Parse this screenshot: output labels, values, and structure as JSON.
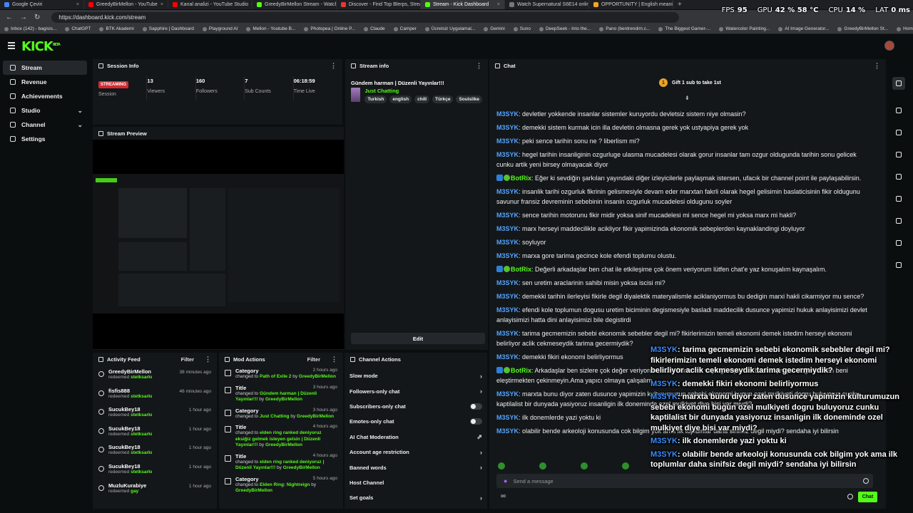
{
  "browser": {
    "tabs": [
      {
        "label": "Google Çeviri",
        "color": "#4285f4"
      },
      {
        "label": "GreedyBirMellon - YouTube",
        "color": "#ff0000"
      },
      {
        "label": "Kanal analizi - YouTube Studio",
        "color": "#ff0000"
      },
      {
        "label": "GreedyBirMellon Stream - Watch",
        "color": "#53fc18"
      },
      {
        "label": "Discover - Find Top Blerps, Strea",
        "color": "#e53935"
      },
      {
        "label": "Stream - Kick Dashboard",
        "color": "#53fc18"
      },
      {
        "label": "Watch Supernatural S6E14 online",
        "color": "#777777"
      },
      {
        "label": "OPPORTUNITY | English meaning",
        "color": "#f5a623"
      }
    ],
    "url": "https://dashboard.kick.com/stream",
    "bookmarks": [
      "Inbox (142) - bagisis...",
      "ChatGPT",
      "BTK Akademi",
      "Sapphire | Dashboard",
      "Playground AI",
      "Mellon - Youtube B...",
      "Photopea | Online P...",
      "Claude",
      "Camper",
      "Ücretsiz Uygulamal...",
      "Gemini",
      "Suno",
      "DeepSeek - Into the...",
      "Pano (bentrendim.c...",
      "The Biggest Gamer-...",
      "Watercolor Painting...",
      "AI Image Generator...",
      "GreedyBirMellon St...",
      "Home / X"
    ]
  },
  "overlay_stats": {
    "fps_label": "FPS",
    "fps": "95",
    "gpu_label": "GPU",
    "gpu": "42 % 58 °C",
    "cpu_label": "CPU",
    "cpu": "14 %",
    "lat_label": "LAT",
    "lat": "0 ms"
  },
  "header": {
    "logo": "KICK",
    "logo_sup": "BETA"
  },
  "sidebar": {
    "items": [
      {
        "label": "Stream",
        "active": true,
        "chevron": false
      },
      {
        "label": "Revenue",
        "chevron": false
      },
      {
        "label": "Achievements",
        "chevron": false
      },
      {
        "label": "Studio",
        "chevron": true
      },
      {
        "label": "Channel",
        "chevron": true
      },
      {
        "label": "Settings",
        "chevron": false
      }
    ]
  },
  "session": {
    "title": "Session Info",
    "status": "STREAMING",
    "status_label": "Session",
    "viewers": "13",
    "viewers_label": "Viewers",
    "followers": "160",
    "followers_label": "Followers",
    "subs": "7",
    "subs_label": "Sub Counts",
    "time": "06:18:59",
    "time_label": "Time Live"
  },
  "preview": {
    "title": "Stream Preview"
  },
  "stream_info": {
    "title": "Stream info",
    "stream_title": "Gündem harman | Düzenli Yayınlar!!!",
    "category": "Just Chatting",
    "tags": [
      "Turkish",
      "english",
      "chill",
      "Türkçe",
      "Soulslike"
    ],
    "edit_label": "Edit"
  },
  "activity": {
    "title": "Activity Feed",
    "filter": "Filter",
    "items": [
      {
        "name": "GreedyBirMellon",
        "sub": "redeemed",
        "reward": "stetksarkı",
        "time": "38 minutes ago"
      },
      {
        "name": "fisfis888",
        "sub": "redeemed",
        "reward": "stetksarkı",
        "time": "46 minutes ago"
      },
      {
        "name": "SucukBey18",
        "sub": "redeemed",
        "reward": "stetksarkı",
        "time": "1 hour ago"
      },
      {
        "name": "SucukBey18",
        "sub": "redeemed",
        "reward": "stetksarkı",
        "time": "1 hour ago"
      },
      {
        "name": "SucukBey18",
        "sub": "redeemed",
        "reward": "stetksarkı",
        "time": "1 hour ago"
      },
      {
        "name": "SucukBey18",
        "sub": "redeemed",
        "reward": "stetksarkı",
        "time": "1 hour ago"
      },
      {
        "name": "MuzluKurabiye",
        "sub": "redeemed",
        "reward": "gay",
        "time": "1 hour ago"
      }
    ]
  },
  "mod": {
    "title": "Mod Actions",
    "filter": "Filter",
    "items": [
      {
        "type": "Category",
        "time": "2 hours ago",
        "pre": "changed to",
        "value": "Path of Exile 2",
        "by": "by",
        "user": "GreedyBirMellon"
      },
      {
        "type": "Title",
        "time": "3 hours ago",
        "pre": "changed to",
        "value": "Gündem harman | Düzenli Yayınlar!!!",
        "by": "by",
        "user": "GreedyBirMellon"
      },
      {
        "type": "Category",
        "time": "3 hours ago",
        "pre": "changed to",
        "value": "Just Chatting",
        "by": "by",
        "user": "GreedyBirMellon"
      },
      {
        "type": "Title",
        "time": "4 hours ago",
        "pre": "changed to",
        "value": "elden ring ranked deniyoruz eksiğiz gelmek isteyen gelsin | Düzenli Yayınlar!!!",
        "by": "by",
        "user": "GreedyBirMellon"
      },
      {
        "type": "Title",
        "time": "4 hours ago",
        "pre": "changed to",
        "value": "elden ring ranked deniyoruz | Düzenli Yayınlar!!!",
        "by": "by",
        "user": "GreedyBirMellon"
      },
      {
        "type": "Category",
        "time": "5 hours ago",
        "pre": "changed to",
        "value": "Elden Ring: Nightreign",
        "by": "by",
        "user": "GreedyBirMellon"
      }
    ]
  },
  "channel_actions": {
    "title": "Channel Actions",
    "items": [
      {
        "label": "Slow mode",
        "control": "chevron"
      },
      {
        "label": "Followers-only chat",
        "control": "chevron"
      },
      {
        "label": "Subscribers-only chat",
        "control": "toggle"
      },
      {
        "label": "Emotes-only chat",
        "control": "toggle"
      },
      {
        "label": "AI Chat Moderation",
        "control": "chart"
      },
      {
        "label": "Account age restriction",
        "control": "chevron"
      },
      {
        "label": "Banned words",
        "control": "chevron"
      },
      {
        "label": "Host Channel",
        "control": "none"
      },
      {
        "label": "Set goals",
        "control": "chevron"
      }
    ]
  },
  "chat": {
    "title": "Chat",
    "gift_count": "1",
    "gift_text": "Gift 1 sub to take 1st",
    "input_placeholder": "Send a message",
    "send_label": "Chat",
    "messages": [
      {
        "user": "M3SYK",
        "bot": false,
        "text": "devletler yokkende insanlar sistemler kuruyordu devletsiz sistem niye olmasin?"
      },
      {
        "user": "M3SYK",
        "bot": false,
        "text": "demekki sistem kurmak icin illa devletin olmasna gerek yok ustyapiya gerek yok"
      },
      {
        "user": "M3SYK",
        "bot": false,
        "text": "peki sence tarihin sonu ne ? liberlism mi?"
      },
      {
        "user": "M3SYK",
        "bot": false,
        "text": "hegel tarihin insanliginin ozgurluge ulasma mucadelesi olarak gorur insanlar tam ozgur oldugunda tarihin sonu gelicek cunku artik yeni birsey olmayacak diyor"
      },
      {
        "user": "BotRix",
        "bot": true,
        "text": "Eğer ki sevdiğin şarkıları yayındaki diğer izleyicilerle paylaşmak istersen, ufacık bir channel point ile paylaşabilirsin."
      },
      {
        "user": "M3SYK",
        "bot": false,
        "text": "insanlik tarihi ozgurluk fikrinin gelismesiyle devam eder marxtan fakrli olarak hegel gelisimin baslaticisinin fikir oldugunu savunur fransiz devreminin sebebinin insanin ozgurluk mucadelesi oldugunu soyler"
      },
      {
        "user": "M3SYK",
        "bot": false,
        "text": "sence tarihin motorunu fikir midir yoksa sinif mucadelesi mi sence hegel mi yoksa marx mi hakli?"
      },
      {
        "user": "M3SYK",
        "bot": false,
        "text": "marx herseyi maddecilikle acikliyor fikir yapimizinda ekonomik sebeplerden kaynaklandingi doyluyor"
      },
      {
        "user": "M3SYK",
        "bot": false,
        "text": "soyluyor"
      },
      {
        "user": "M3SYK",
        "bot": false,
        "text": "marxa gore tarima gecince kole efendi toplumu olustu."
      },
      {
        "user": "BotRix",
        "bot": true,
        "text": "Değerli arkadaşlar ben chat ile etkileşime çok önem veriyorum lütfen chat'e yaz konuşalım kaynaşalım."
      },
      {
        "user": "M3SYK",
        "bot": false,
        "text": "sen uretim araclarinin sahibi misin yoksa iscisi mi?"
      },
      {
        "user": "M3SYK",
        "bot": false,
        "text": "demekki tarihin ilerleyisi fikirle degil diyalektik materyalismle aciklaniyormus bu dedigin marxi hakli cikarmiyor mu sence?"
      },
      {
        "user": "M3SYK",
        "bot": false,
        "text": "efendi kole toplumun dogusu uretim biciminin degismesiyle basladi maddecilik dusunce yapimizi hukuk anlayisimizi devlet anlayisimizi hatta dini anlayisimizi bile degistirdi"
      },
      {
        "user": "M3SYK",
        "bot": false,
        "text": "tarima gecmemizin sebebi ekonomik sebebler degil mi? fikirlerimizin temeli ekonomi demek istedim herseyi ekonomi belirliyor aclik cekmeseydik tarima gecermiydik?"
      },
      {
        "user": "M3SYK",
        "bot": false,
        "text": "demekki fikiri ekonomi belirliyormus"
      },
      {
        "user": "BotRix",
        "bot": true,
        "text": "Arkadaşlar ben sizlere çok değer veriyorum, sizin fikirleriniz veya görüşleriniz benim için çok değerli lütfen beni eleştirmekten çekinmeyin.Ama yapıcı olmaya çalışalım."
      },
      {
        "user": "M3SYK",
        "bot": false,
        "text": "marxta bunu diyor zaten dusunce yapimizin kulturumuzun sebebi ekonomi bugun ozel mulkiyeti dogru buluyoruz cunku kaptilalist bir dunyada yasiyoruz insanligin ilk doneminde ozel mulkiyet diye bisi var miydi?"
      },
      {
        "user": "M3SYK",
        "bot": false,
        "text": "ilk donemlerde yazi yoktu ki"
      },
      {
        "user": "M3SYK",
        "bot": false,
        "text": "olabilir bende arkeoloji konusunda cok bilgim yok ama ilk toplumlar daha sinifsiz degil miydi? sendaha iyi bilirsin"
      }
    ]
  },
  "captions": [
    {
      "user": "M3SYK",
      "text": ": tarima gecmemizin sebebi ekonomik sebebler degil mi? fikirlerimizin temeli ekonomi demek istedim herseyi ekonomi belirliyor aclik cekmeseydik tarima gecermiydik?"
    },
    {
      "user": "M3SYK",
      "text": ": demekki fikiri ekonomi belirliyormus"
    },
    {
      "user": "M3SYK",
      "text": ": marxta bunu diyor zaten dusunce yapimizin kulturumuzun sebebi ekonomi bugun ozel mulkiyeti dogru buluyoruz cunku kaptilalist bir dunyada yasiyoruz insanligin ilk doneminde ozel mulkiyet diye bisi var miydi?"
    },
    {
      "user": "M3SYK",
      "text": ": ilk donemlerde yazi yoktu ki"
    },
    {
      "user": "M3SYK",
      "text": ": olabilir bende arkeoloji konusunda cok bilgim yok ama ilk toplumlar daha sinifsiz degil miydi? sendaha iyi bilirsin"
    }
  ],
  "colors": {
    "accent": "#53fc18",
    "live": "#d02b32",
    "username": "#53a4ff"
  }
}
